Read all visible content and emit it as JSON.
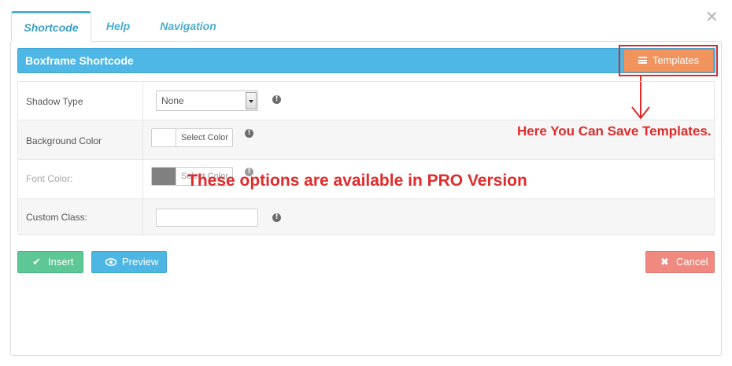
{
  "tabs": [
    {
      "label": "Shortcode",
      "active": true
    },
    {
      "label": "Help",
      "active": false
    },
    {
      "label": "Navigation",
      "active": false
    }
  ],
  "close_icon": "close-icon",
  "header": {
    "title": "Boxframe Shortcode",
    "templates_label": "Templates",
    "color": "#4fb7e5",
    "templates_color": "#f0935d"
  },
  "form": {
    "shadow_type": {
      "label": "Shadow Type",
      "value": "None"
    },
    "background_color": {
      "label": "Background Color",
      "button_label": "Select Color",
      "swatch": "#ffffff"
    },
    "font_color": {
      "label": "Font Color:",
      "button_label": "Select Color",
      "swatch": "#808080"
    },
    "custom_class": {
      "label": "Custom Class:",
      "value": ""
    }
  },
  "annotations": {
    "save_templates": "Here You Can Save Templates.",
    "pro_version": "These options are available in PRO Version",
    "color": "#e02b2b"
  },
  "actions": {
    "insert_label": "Insert",
    "preview_label": "Preview",
    "cancel_label": "Cancel",
    "insert_color": "#5ec796",
    "preview_color": "#4db6e3",
    "cancel_color": "#f08a80"
  }
}
